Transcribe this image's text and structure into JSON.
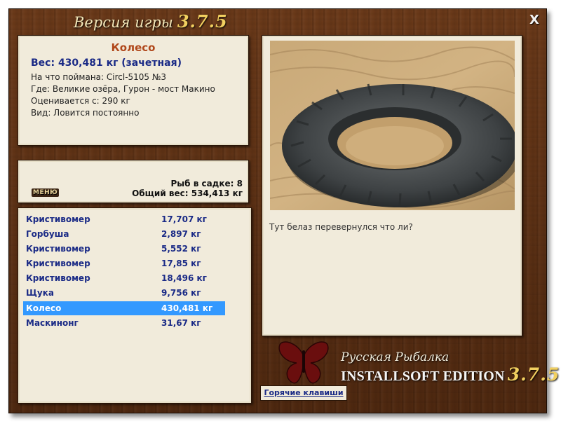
{
  "window": {
    "title_prefix": "Версия игры",
    "title_version": "3.7.5",
    "close_label": "X"
  },
  "info": {
    "title": "Колесо",
    "weight": "Вес: 430,481 кг (зачетная)",
    "lines": [
      "На что поймана: Circl-5105 №3",
      "Где: Великие озёра, Гурон - мост Макино",
      "Оценивается с: 290 кг",
      "Вид: Ловится постоянно"
    ]
  },
  "stats": {
    "menu_label": "МЕНЮ",
    "fish_count": "Рыб в садке: 8",
    "total_weight": "Общий вес: 534,413 кг"
  },
  "catch_list": [
    {
      "name": "Кристивомер",
      "weight": "17,707 кг",
      "selected": false
    },
    {
      "name": "Горбуша",
      "weight": "2,897 кг",
      "selected": false
    },
    {
      "name": "Кристивомер",
      "weight": "5,552 кг",
      "selected": false
    },
    {
      "name": "Кристивомер",
      "weight": "17,85 кг",
      "selected": false
    },
    {
      "name": "Кристивомер",
      "weight": "18,496 кг",
      "selected": false
    },
    {
      "name": "Щука",
      "weight": "9,756 кг",
      "selected": false
    },
    {
      "name": "Колесо",
      "weight": "430,481 кг",
      "selected": true
    },
    {
      "name": "Маскинонг",
      "weight": "31,67 кг",
      "selected": false
    }
  ],
  "photo": {
    "icon": "tire-on-sand-image",
    "caption": "Тут белаз перевернулся что ли?"
  },
  "logo": {
    "line1": "Русская Рыбалка",
    "line2": "INSTALLSOFT EDITION",
    "version": "3.7.5",
    "icon": "butterfly-icon"
  },
  "hotkeys_label": "Горячие клавиши",
  "colors": {
    "selected_row": "#3399ff",
    "item_title": "#b0471a",
    "list_text": "#1a2a86",
    "accent_gold": "#f2d060"
  }
}
